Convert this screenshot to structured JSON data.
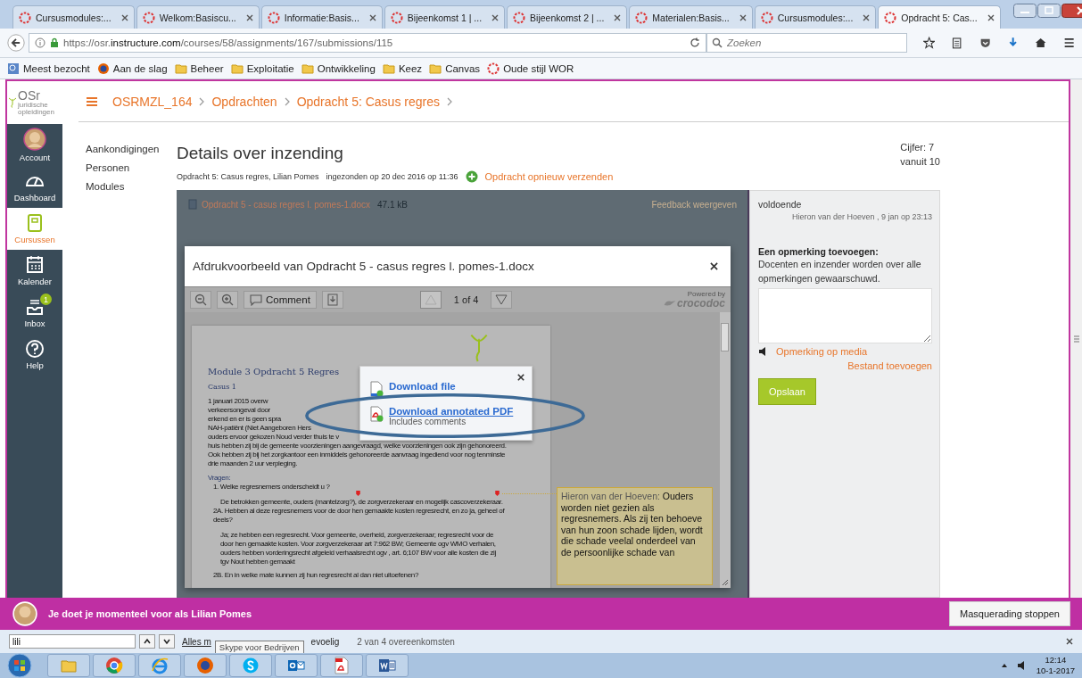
{
  "browser": {
    "tabs": [
      {
        "title": "Cursusmodules:...",
        "selected": false
      },
      {
        "title": "Welkom:Basiscu...",
        "selected": false
      },
      {
        "title": "Informatie:Basis...",
        "selected": false
      },
      {
        "title": "Bijeenkomst 1 | ...",
        "selected": false
      },
      {
        "title": "Bijeenkomst 2 | ...",
        "selected": false
      },
      {
        "title": "Materialen:Basis...",
        "selected": false
      },
      {
        "title": "Cursusmodules:...",
        "selected": false
      },
      {
        "title": "Opdracht 5: Cas...",
        "selected": true
      }
    ],
    "url_prefix": "https://osr.",
    "url_domain": "instructure.com",
    "url_path": "/courses/58/assignments/167/submissions/115",
    "search_placeholder": "Zoeken",
    "bookmarks": [
      {
        "label": "Meest bezocht",
        "kind": "history"
      },
      {
        "label": "Aan de slag",
        "kind": "firefox"
      },
      {
        "label": "Beheer",
        "kind": "folder"
      },
      {
        "label": "Exploitatie",
        "kind": "folder"
      },
      {
        "label": "Ontwikkeling",
        "kind": "folder"
      },
      {
        "label": "Keez",
        "kind": "folder"
      },
      {
        "label": "Canvas",
        "kind": "folder"
      },
      {
        "label": "Oude stijl WOR",
        "kind": "canvas"
      }
    ]
  },
  "logo": {
    "name": "OSr",
    "tagline": "juridische opleidingen"
  },
  "global_nav": [
    {
      "label": "Account",
      "kind": "avatar",
      "selected": false
    },
    {
      "label": "Dashboard",
      "kind": "dashboard",
      "selected": false
    },
    {
      "label": "Cursussen",
      "kind": "courses",
      "selected": true
    },
    {
      "label": "Kalender",
      "kind": "calendar",
      "selected": false
    },
    {
      "label": "Inbox",
      "kind": "inbox",
      "selected": false,
      "badge": "1"
    },
    {
      "label": "Help",
      "kind": "help",
      "selected": false
    }
  ],
  "breadcrumb": [
    "OSRMZL_164",
    "Opdrachten",
    "Opdracht 5: Casus regres"
  ],
  "course_nav": [
    "Aankondigingen",
    "Personen",
    "Modules"
  ],
  "heading": "Details over inzending",
  "meta": {
    "assignment": "Opdracht 5: Casus regres, Lilian Pomes",
    "submitted": "ingezonden op 20 dec 2016 op 11:36",
    "resubmit": "Opdracht opnieuw verzenden"
  },
  "grade": {
    "label": "Cijfer: 7",
    "out_of": "vanuit 10"
  },
  "file": {
    "name": "Opdracht 5 - casus regres l. pomes-1.docx",
    "size": "47.1 kB"
  },
  "feedback_link": "Feedback weergeven",
  "comments": [
    {
      "text": "voldoende",
      "byline": "Hieron van der Hoeven , 9 jan op 23:13"
    }
  ],
  "add_comment": {
    "title": "Een opmerking toevoegen:",
    "hint": "Docenten en inzender worden over alle opmerkingen gewaarschuwd.",
    "media": "Opmerking op media",
    "attach": "Bestand toevoegen",
    "save": "Opslaan"
  },
  "preview": {
    "title": "Afdrukvoorbeeld van Opdracht 5 - casus regres l. pomes-1.docx",
    "comment_button": "Comment",
    "page": "1 of 4",
    "powered_by": "Powered by",
    "brand": "crocodoc",
    "doc": [
      {
        "kind": "title",
        "text": "Module 3 Opdracht 5 Regres"
      },
      {
        "kind": "subtitle",
        "text": "Casus 1"
      },
      {
        "kind": "cut",
        "text": "1 januari 2015 overw"
      },
      {
        "kind": "cut",
        "text": "verkeersongeval door"
      },
      {
        "kind": "cut",
        "text": "erkend en er is geen spra"
      },
      {
        "kind": "cut",
        "text": "NAH-patiënt (Niet Aangeboren Hers"
      },
      {
        "kind": "cut",
        "text": "ouders ervoor gekozen Noud verder thuis te v"
      },
      {
        "kind": "body",
        "text": "huis hebben zij bij de gemeente voorzieningen aangevraagd, welke voorzieningen ook zijn gehonoreerd."
      },
      {
        "kind": "body",
        "text": "Ook hebben zij bij het zorgkantoor een inmiddels gehonoreerde aanvraag ingediend voor nog tenminste"
      },
      {
        "kind": "body",
        "text": "drie maanden 2 uur verpleging."
      },
      {
        "kind": "heading",
        "text": "Vragen:"
      },
      {
        "kind": "question",
        "text": "1.   Welke regresnemers onderscheidt u ?"
      },
      {
        "kind": "answer",
        "text": "De betrokken gemeente, ouders (mantelzorg?),  de zorgverzekeraar en mogelijk cascoverzekeraar."
      },
      {
        "kind": "question",
        "text": "2A. Hebben al deze regresnemers voor de door hen gemaakte kosten regresrecht, en zo ja, geheel of"
      },
      {
        "kind": "question",
        "text": "deels?"
      },
      {
        "kind": "answer",
        "text": "Ja; ze hebben een regresrecht. Voor gemeente, overheid, zorgverzekeraar; regresrecht voor de"
      },
      {
        "kind": "answer",
        "text": "door hen gemaakte kosten. Voor zorgverzekeraar art 7:962 BW; Gemeente ogv WMO verhalen,"
      },
      {
        "kind": "answer",
        "text": "ouders hebben vorderingsrecht afgeleid verhaalsrecht ogv , art. 6;107 BW voor alle kosten die zij"
      },
      {
        "kind": "answer",
        "text": "tgv Nout hebben gemaakt"
      },
      {
        "kind": "gap",
        "text": "2B. En in welke mate kunnen zij hun regresrecht al dan niet uitoefenen?"
      }
    ],
    "annotation": {
      "author": "Hieron van der Hoeven:",
      "text": "Ouders worden niet gezien als regresnemers. Als zij ten behoeve van hun zoon schade lijden, wordt die schade veelal onderdeel van de persoonlijke schade van"
    },
    "download_menu": [
      {
        "kind": "file",
        "label": "Download file"
      },
      {
        "kind": "pdf",
        "label": "Download annotated PDF",
        "sub": "Includes comments"
      }
    ]
  },
  "masquerade": {
    "text": "Je doet je momenteel voor als Lilian Pomes",
    "button": "Masquerading stoppen"
  },
  "find_bar": {
    "value": "lili",
    "highlight_all": "Alles m",
    "tooltip": "Skype voor Bedrijven",
    "match_case": "evoelig",
    "result": "2 van 4 overeenkomsten"
  },
  "taskbar": {
    "apps": [
      {
        "kind": "start"
      },
      {
        "kind": "explorer"
      },
      {
        "kind": "chrome"
      },
      {
        "kind": "ie"
      },
      {
        "kind": "firefox"
      },
      {
        "kind": "skype"
      },
      {
        "kind": "outlook"
      },
      {
        "kind": "pdf"
      },
      {
        "kind": "word"
      }
    ],
    "time": "12:14",
    "date": "10-1-2017"
  }
}
